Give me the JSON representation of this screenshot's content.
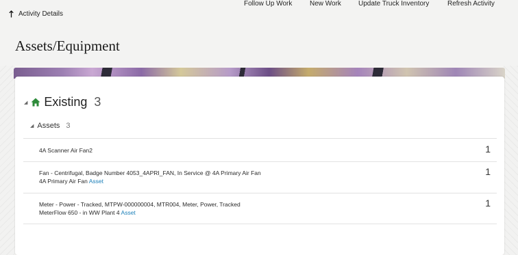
{
  "nav": {
    "back_label": "Activity Details"
  },
  "header": {
    "title": "Assets/Equipment",
    "actions": [
      "Follow Up Work",
      "New Work",
      "Update Truck Inventory",
      "Refresh Activity"
    ]
  },
  "section": {
    "title": "Existing",
    "count": "3",
    "subsection": {
      "label": "Assets",
      "count": "3",
      "rows": [
        {
          "line1": "4A Scanner Air Fan2",
          "line2": "",
          "link": "",
          "qty": "1"
        },
        {
          "line1": "Fan - Centrifugal, Badge Number 4053_4APRI_FAN, In Service @ 4A Primary Air Fan",
          "line2": "4A Primary Air Fan",
          "link": "Asset",
          "qty": "1"
        },
        {
          "line1": "Meter - Power - Tracked, MTPW-000000004, MTR004, Meter, Power, Tracked",
          "line2": "MeterFlow 650 - in WW Plant 4",
          "link": "Asset",
          "qty": "1"
        }
      ]
    }
  },
  "colors": {
    "accent_link": "#1b7fb8",
    "home_icon": "#2e8b3a"
  }
}
